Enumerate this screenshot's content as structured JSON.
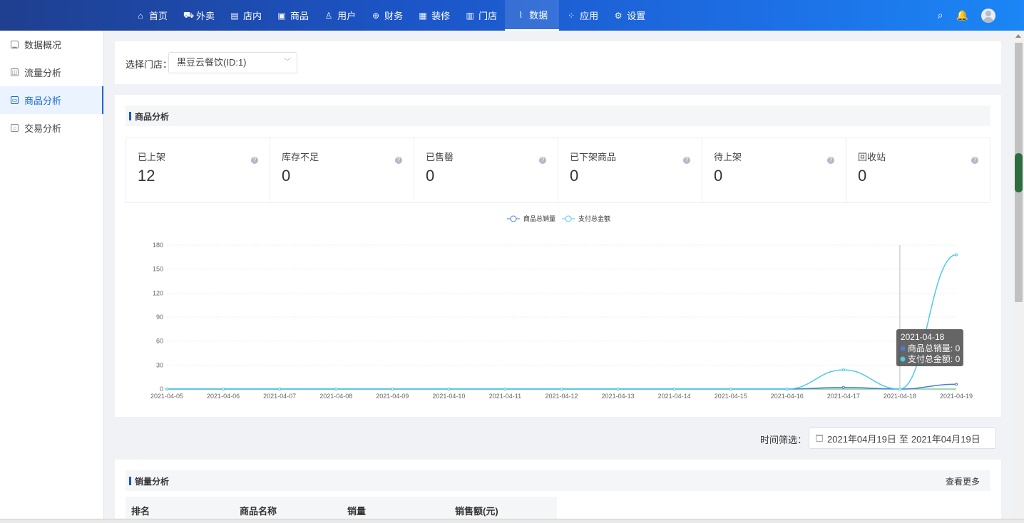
{
  "nav": {
    "items": [
      {
        "label": "首页",
        "icon": "home-icon",
        "glyph": "⌂"
      },
      {
        "label": "外卖",
        "icon": "scooter-icon",
        "glyph": "⛟"
      },
      {
        "label": "店内",
        "icon": "doc-icon",
        "glyph": "▤"
      },
      {
        "label": "商品",
        "icon": "goods-icon",
        "glyph": "▣"
      },
      {
        "label": "用户",
        "icon": "user-icon",
        "glyph": "♙"
      },
      {
        "label": "财务",
        "icon": "lock-icon",
        "glyph": "⊕"
      },
      {
        "label": "装修",
        "icon": "store-icon",
        "glyph": "▦"
      },
      {
        "label": "门店",
        "icon": "shop-icon",
        "glyph": "▥"
      },
      {
        "label": "数据",
        "icon": "chart-icon",
        "glyph": "⌇",
        "active": true
      },
      {
        "label": "应用",
        "icon": "apps-icon",
        "glyph": "⁘"
      },
      {
        "label": "设置",
        "icon": "gear-icon",
        "glyph": "⚙"
      }
    ],
    "search_glyph": "⌕",
    "bell_glyph": "🔔"
  },
  "sidebar": {
    "items": [
      {
        "label": "数据概况",
        "icon": "overview-icon",
        "glyph": "▁"
      },
      {
        "label": "流量分析",
        "icon": "traffic-icon",
        "glyph": "◫"
      },
      {
        "label": "商品分析",
        "icon": "goods-analysis-icon",
        "glyph": "▭",
        "active": true
      },
      {
        "label": "交易分析",
        "icon": "trade-icon",
        "glyph": "⌂"
      }
    ]
  },
  "store": {
    "label": "选择门店：",
    "value": "黑豆云餐饮(ID:1)",
    "arrow": "﹀"
  },
  "goods": {
    "section_title": "商品分析",
    "stats": [
      {
        "label": "已上架",
        "value": "12"
      },
      {
        "label": "库存不足",
        "value": "0"
      },
      {
        "label": "已售罄",
        "value": "0"
      },
      {
        "label": "已下架商品",
        "value": "0"
      },
      {
        "label": "待上架",
        "value": "0"
      },
      {
        "label": "回收站",
        "value": "0"
      }
    ],
    "help_glyph": "?"
  },
  "chart_data": {
    "type": "line",
    "x": [
      "2021-04-05",
      "2021-04-06",
      "2021-04-07",
      "2021-04-08",
      "2021-04-09",
      "2021-04-10",
      "2021-04-11",
      "2021-04-12",
      "2021-04-13",
      "2021-04-14",
      "2021-04-15",
      "2021-04-16",
      "2021-04-17",
      "2021-04-18",
      "2021-04-19"
    ],
    "series": [
      {
        "name": "商品总销量",
        "color": "#4a7bd6",
        "values": [
          0,
          0,
          0,
          0,
          0,
          0,
          0,
          0,
          0,
          0,
          0,
          0,
          2,
          0,
          6
        ]
      },
      {
        "name": "支付总金额",
        "color": "#4ccbe6",
        "values": [
          0,
          0,
          0,
          0,
          0,
          0,
          0,
          0,
          0,
          0,
          0,
          0,
          24,
          0,
          168
        ]
      }
    ],
    "extra_series_color": "#5fc487",
    "yticks": [
      0,
      30,
      60,
      90,
      120,
      150,
      180
    ],
    "ylim": [
      0,
      180
    ],
    "legend": "top-center",
    "grid": true,
    "tooltip": {
      "date": "2021-04-18",
      "lines": [
        "商品总销量: 0",
        "支付总金额: 0"
      ]
    }
  },
  "filter": {
    "label": "时间筛选：",
    "start": "2021年04月19日",
    "separator": "至",
    "end": "2021年04月19日"
  },
  "sales": {
    "section_title": "销量分析",
    "more": "查看更多",
    "columns": [
      "排名",
      "商品名称",
      "销量",
      "销售额(元)"
    ]
  }
}
